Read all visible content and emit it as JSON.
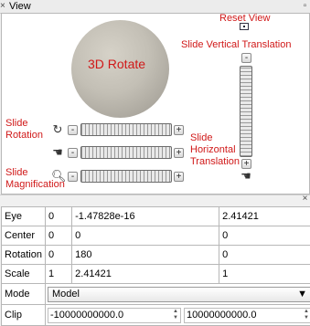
{
  "window": {
    "title": "View"
  },
  "view": {
    "sphere_label": "3D Rotate",
    "reset_label": "Reset View",
    "slide_vertical_label": "Slide Vertical Translation",
    "slide_rotation_label_1": "Slide",
    "slide_rotation_label_2": "Rotation",
    "slide_horizontal_label_1": "Slide",
    "slide_horizontal_label_2": "Horizontal",
    "slide_horizontal_label_3": "Translation",
    "slide_magnification_label_1": "Slide",
    "slide_magnification_label_2": "Magnification",
    "minus": "-",
    "plus": "+",
    "icons": [
      "rotate-icon",
      "hand-icon",
      "magnifier-icon",
      "reset-view-icon"
    ]
  },
  "properties": {
    "eye": {
      "label": "Eye",
      "values": [
        "0",
        "-1.47828e-16",
        "2.41421"
      ]
    },
    "center": {
      "label": "Center",
      "values": [
        "0",
        "0",
        "0"
      ]
    },
    "rotation": {
      "label": "Rotation",
      "values": [
        "0",
        "180",
        "0"
      ]
    },
    "scale": {
      "label": "Scale",
      "values": [
        "1",
        "2.41421",
        "1"
      ]
    },
    "mode": {
      "label": "Mode",
      "selected": "Model"
    },
    "clip": {
      "label": "Clip",
      "near": "-10000000000.0",
      "far": "10000000000.0"
    }
  }
}
